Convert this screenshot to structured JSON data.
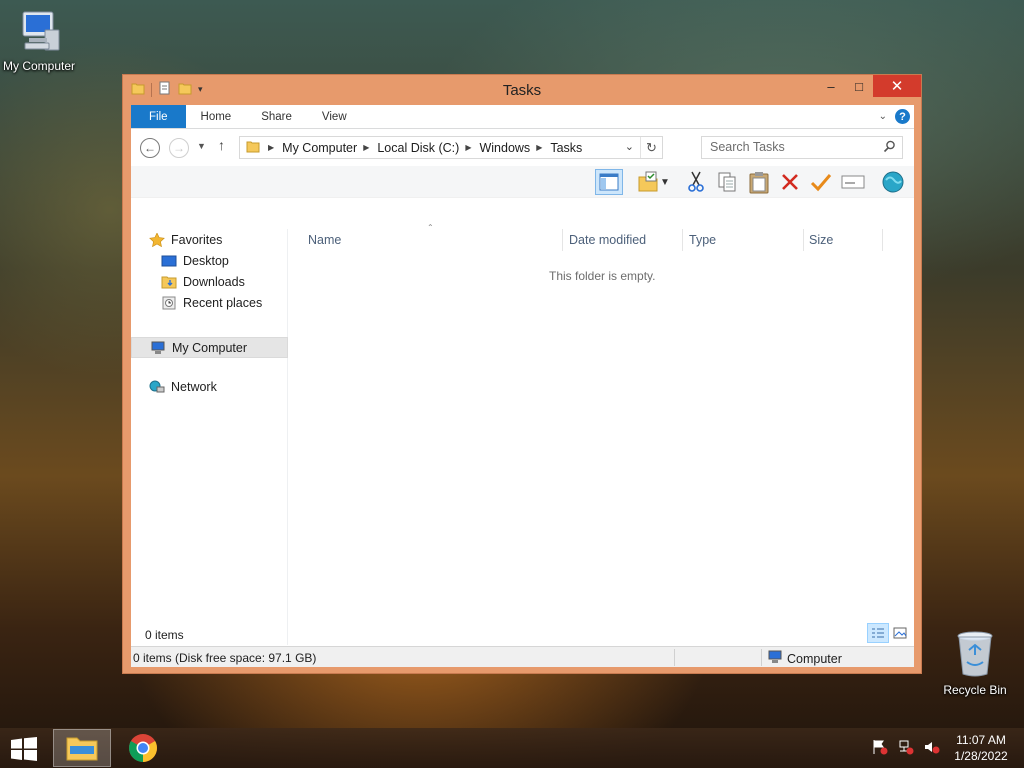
{
  "desktop": {
    "icons": [
      {
        "label": "My Computer"
      },
      {
        "label": "Recycle Bin"
      }
    ]
  },
  "window": {
    "title": "Tasks",
    "controls": {
      "minimize": "–",
      "maximize": "□",
      "close": "✕"
    }
  },
  "ribbon": {
    "tabs": [
      "File",
      "Home",
      "Share",
      "View"
    ]
  },
  "address": {
    "crumbs": [
      "My Computer",
      "Local Disk (C:)",
      "Windows",
      "Tasks"
    ],
    "search_placeholder": "Search Tasks"
  },
  "navpane": {
    "favorites": "Favorites",
    "desktop": "Desktop",
    "downloads": "Downloads",
    "recent": "Recent places",
    "computer": "My Computer",
    "network": "Network"
  },
  "columns": [
    "Name",
    "Date modified",
    "Type",
    "Size"
  ],
  "content": {
    "empty_message": "This folder is empty.",
    "item_count": "0 items"
  },
  "statusbar": {
    "left": "0 items (Disk free space: 97.1 GB)",
    "right": "Computer"
  },
  "taskbar": {
    "time": "11:07 AM",
    "date": "1/28/2022"
  },
  "colors": {
    "window_frame": "#e79a6c",
    "file_tab": "#1979ca",
    "close_button": "#d33b2c"
  }
}
